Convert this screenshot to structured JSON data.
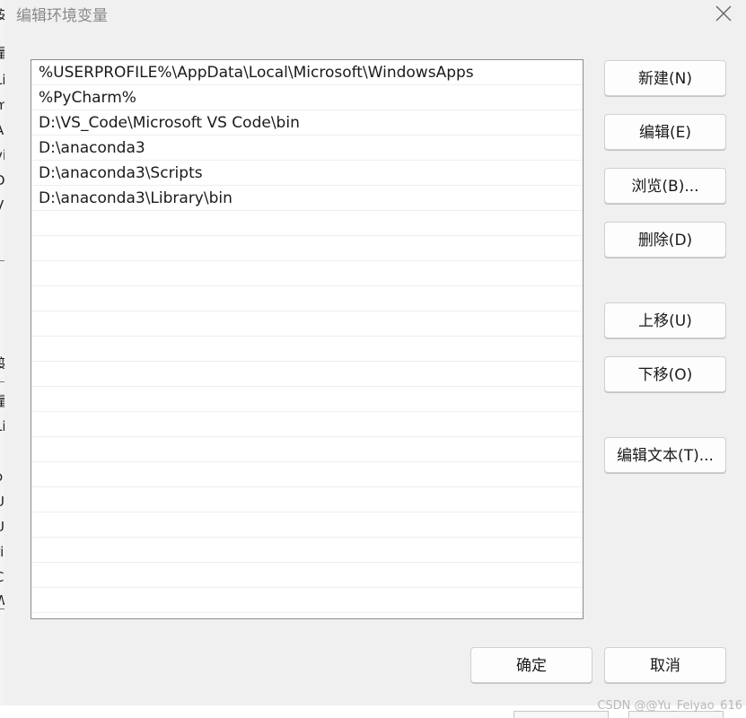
{
  "background_window": {
    "left_fragments": [
      "安",
      "量",
      "Li",
      "m",
      "A",
      "vi",
      "Di",
      "Vi",
      "变",
      "量",
      "Li",
      "I",
      "o",
      "U",
      "U",
      "ri",
      "C",
      "W"
    ]
  },
  "dialog": {
    "title": "编辑环境变量",
    "close_icon": "close-icon",
    "path_entries": [
      "%USERPROFILE%\\AppData\\Local\\Microsoft\\WindowsApps",
      "%PyCharm%",
      "D:\\VS_Code\\Microsoft VS Code\\bin",
      "D:\\anaconda3",
      "D:\\anaconda3\\Scripts",
      "D:\\anaconda3\\Library\\bin",
      "",
      "",
      "",
      "",
      "",
      "",
      "",
      "",
      "",
      "",
      "",
      "",
      "",
      "",
      "",
      ""
    ],
    "buttons": {
      "new": "新建(N)",
      "edit": "编辑(E)",
      "browse": "浏览(B)...",
      "delete": "删除(D)",
      "move_up": "上移(U)",
      "move_down": "下移(O)",
      "edit_text": "编辑文本(T)...",
      "ok": "确定",
      "cancel": "取消"
    }
  },
  "watermark": "CSDN @@Yu_Feiyao_616"
}
